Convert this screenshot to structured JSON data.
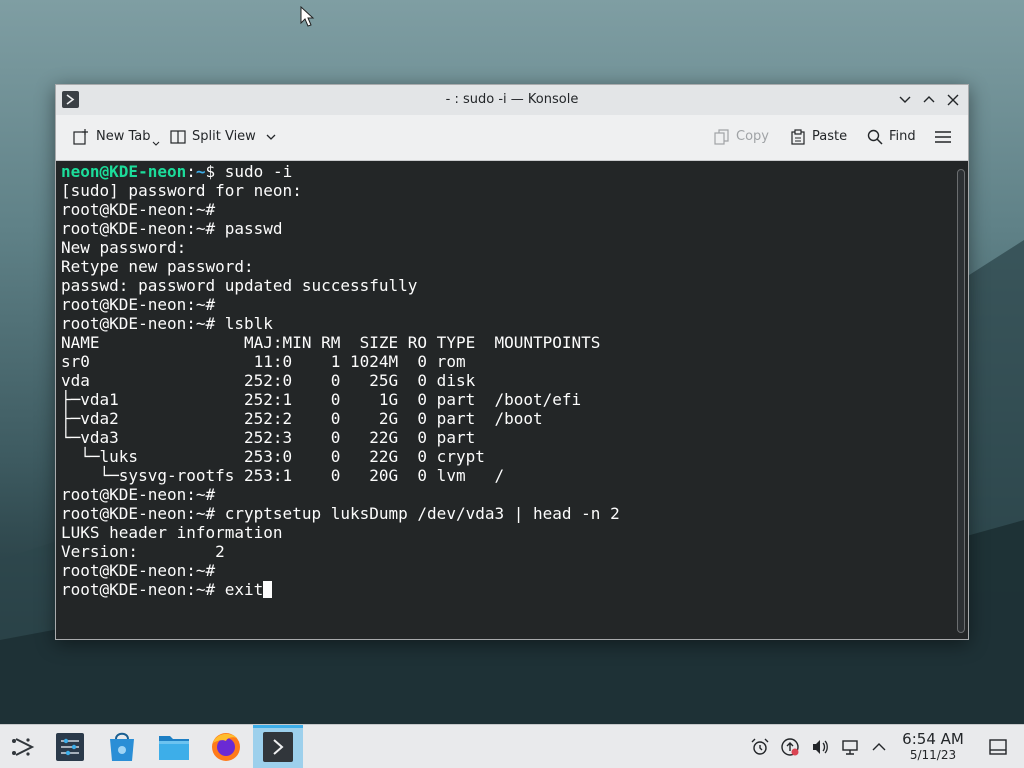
{
  "window": {
    "title": "- : sudo -i — Konsole"
  },
  "toolbar": {
    "new_tab": "New Tab",
    "split_view": "Split View",
    "copy": "Copy",
    "paste": "Paste",
    "find": "Find"
  },
  "terminal": {
    "prompt_user": "neon@KDE-neon",
    "prompt_sep": ":",
    "prompt_tilde": "~",
    "first_cmd": "$ sudo -i",
    "lines": [
      "[sudo] password for neon:",
      "root@KDE-neon:~#",
      "root@KDE-neon:~# passwd",
      "New password:",
      "Retype new password:",
      "passwd: password updated successfully",
      "root@KDE-neon:~#",
      "root@KDE-neon:~# lsblk",
      "NAME               MAJ:MIN RM  SIZE RO TYPE  MOUNTPOINTS",
      "sr0                 11:0    1 1024M  0 rom",
      "vda                252:0    0   25G  0 disk",
      "├─vda1             252:1    0    1G  0 part  /boot/efi",
      "├─vda2             252:2    0    2G  0 part  /boot",
      "└─vda3             252:3    0   22G  0 part",
      "  └─luks           253:0    0   22G  0 crypt",
      "    └─sysvg-rootfs 253:1    0   20G  0 lvm   /",
      "root@KDE-neon:~#",
      "root@KDE-neon:~# cryptsetup luksDump /dev/vda3 | head -n 2",
      "LUKS header information",
      "Version:        2",
      "root@KDE-neon:~#"
    ],
    "last_line": "root@KDE-neon:~# exit"
  },
  "taskbar": {
    "apps": [
      "application-launcher-icon",
      "system-settings-icon",
      "discover-icon",
      "dolphin-icon",
      "firefox-icon",
      "konsole-icon"
    ]
  },
  "clock": {
    "time": "6:54 AM",
    "date": "5/11/23"
  },
  "colors": {
    "terminal_bg": "#232627",
    "prompt_user": "#1cdc9a",
    "prompt_path": "#3daee9",
    "active_task": "#9dd0ec"
  }
}
